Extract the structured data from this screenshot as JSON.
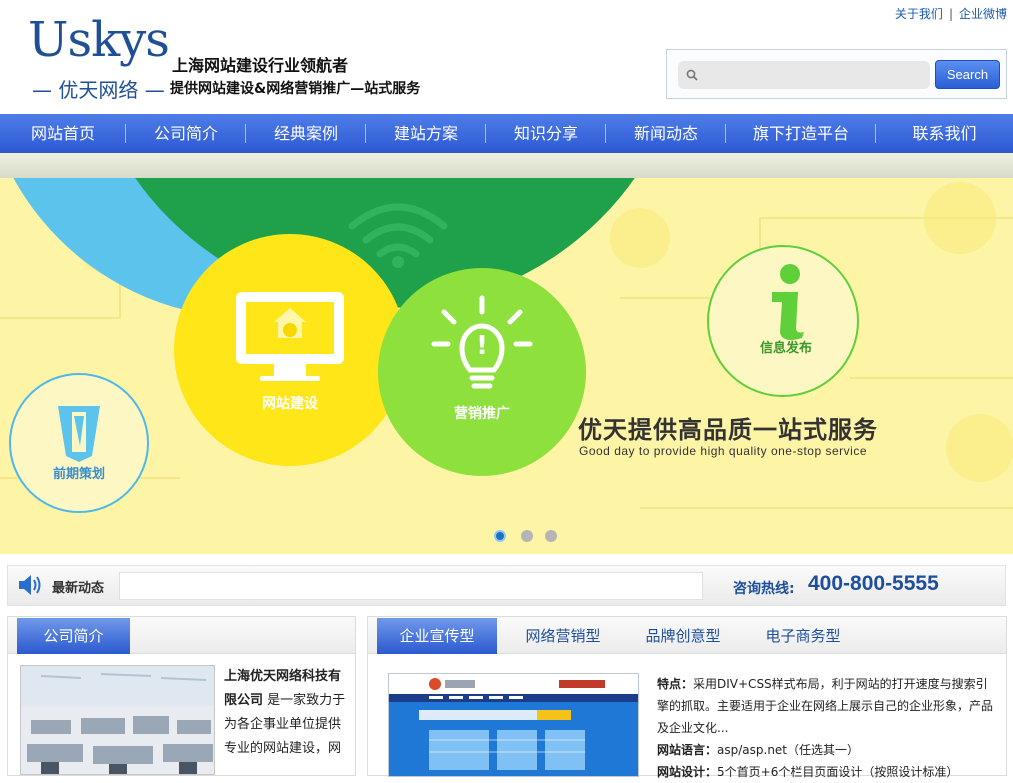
{
  "header": {
    "logo_en": "Uskys",
    "logo_cn": "— 优天网络 —",
    "tagline1": "上海网站建设行业领航者",
    "tagline2": "提供网站建设&网络营销推广—站式服务",
    "top_links": [
      "关于我们",
      "企业微博"
    ],
    "search_placeholder": "",
    "search_button": "Search"
  },
  "nav": {
    "items": [
      "网站首页",
      "公司简介",
      "经典案例",
      "建站方案",
      "知识分享",
      "新闻动态",
      "旗下打造平台",
      "联系我们"
    ]
  },
  "banner": {
    "circles": [
      "前期策划",
      "网站建设",
      "营销推广",
      "信息发布"
    ],
    "headline": "优天提供高品质一站式服务",
    "subline": "Good day to provide high quality one-stop service",
    "slides": 3,
    "active_slide": 1
  },
  "newsbar": {
    "label": "最新动态",
    "hotline_label": "咨询热线:",
    "hotline_number": "400-800-5555"
  },
  "about": {
    "tab": "公司简介",
    "company_name": "上海优天网络科技有限公司",
    "text": "是一家致力于为各企事业单位提供专业的网站建设，网"
  },
  "cases": {
    "tabs": [
      "企业宣传型",
      "网络营销型",
      "品牌创意型",
      "电子商务型"
    ],
    "active_tab": 0,
    "feature_label": "特点：",
    "feature_text": "采用DIV+CSS样式布局，利于网站的打开速度与搜索引擎的抓取。主要适用于企业在网络上展示自己的企业形象，产品及企业文化...",
    "language_label": "网站语言：",
    "language_text": "asp/asp.net（任选其一）",
    "design_label": "网站设计：",
    "design_text": "5个首页+6个栏目页面设计（按照设计标准）"
  },
  "colors": {
    "brand_blue": "#1f4f97",
    "nav_blue": "#2c59d4",
    "banner_bg": "#fdf4a6",
    "circle_yellow": "#ffe619",
    "circle_green": "#8ee03c",
    "circle_dark_green": "#1ea14a",
    "circle_blue": "#5cc3ec"
  }
}
